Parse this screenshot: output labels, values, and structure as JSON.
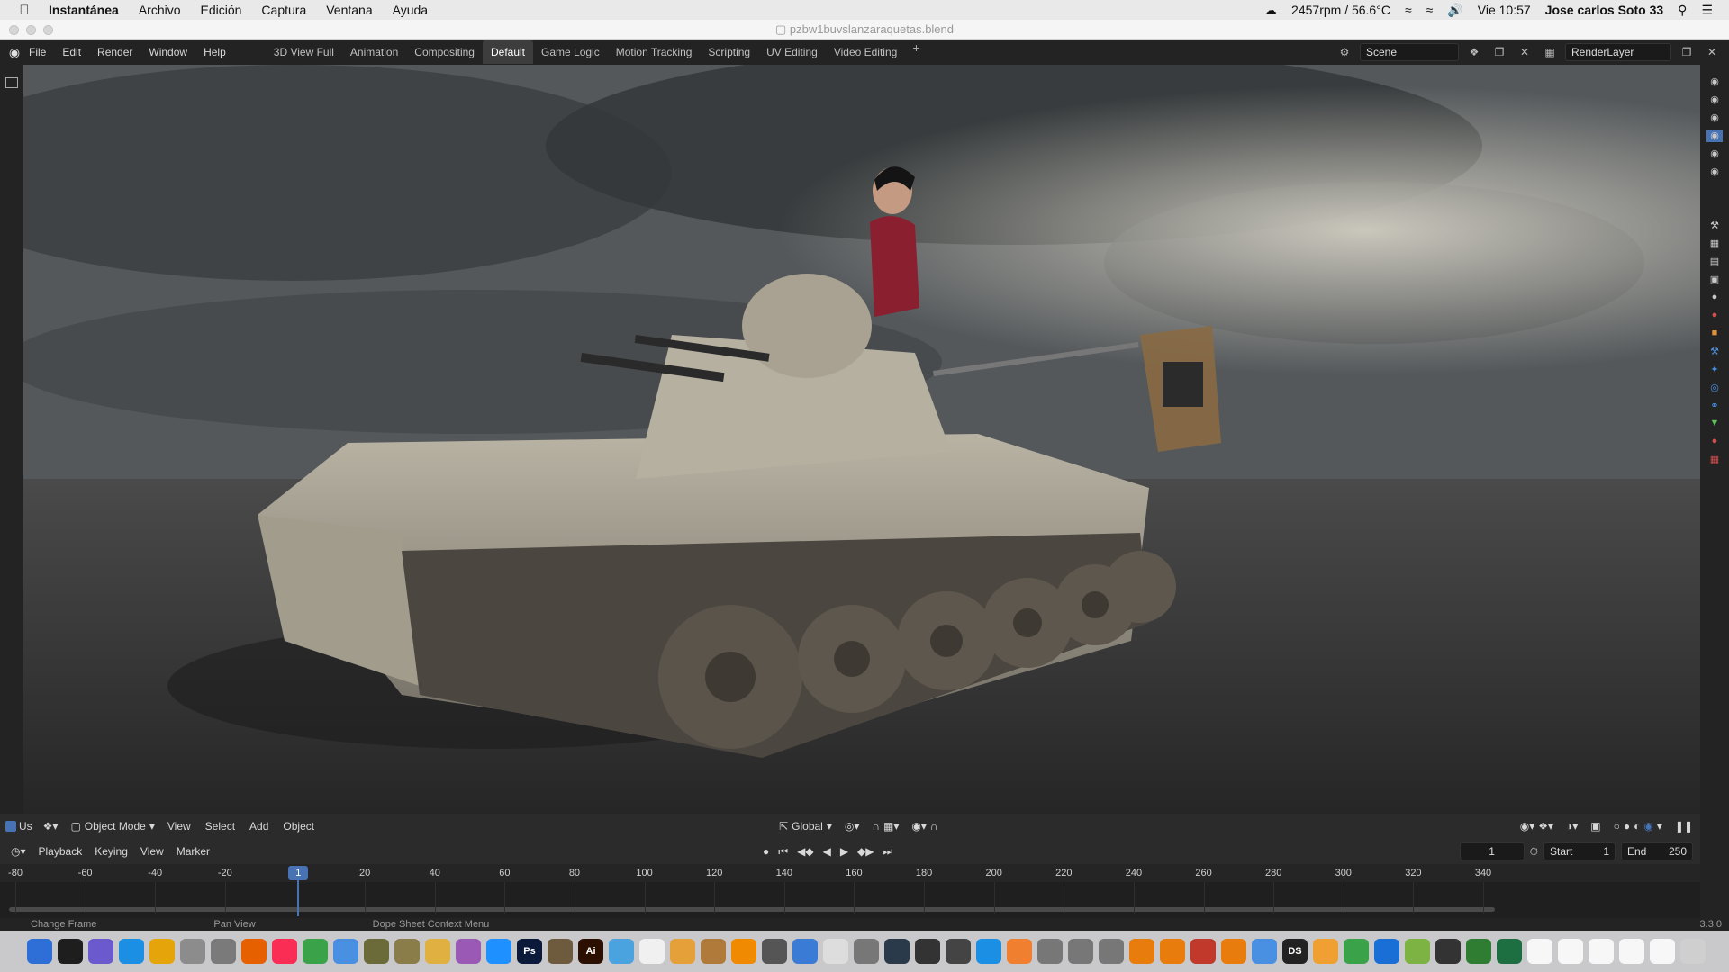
{
  "mac_menubar": {
    "app_name": "Instantánea",
    "menus": [
      "Archivo",
      "Edición",
      "Captura",
      "Ventana",
      "Ayuda"
    ],
    "status": "2457rpm / 56.6°C",
    "clock": "Vie 10:57",
    "user": "Jose carlos Soto 33"
  },
  "window": {
    "title": "pzbw1buvslanzaraquetas.blend"
  },
  "topbar": {
    "menus": [
      "File",
      "Edit",
      "Render",
      "Window",
      "Help"
    ],
    "workspaces": [
      "3D View Full",
      "Animation",
      "Compositing",
      "Default",
      "Game Logic",
      "Motion Tracking",
      "Scripting",
      "UV Editing",
      "Video Editing"
    ],
    "active_workspace": "Default",
    "add_tab": "+",
    "scene": "Scene",
    "render_layer": "RenderLayer"
  },
  "viewport_header": {
    "checkbox_label": "Us",
    "mode": "Object Mode",
    "menus": [
      "View",
      "Select",
      "Add",
      "Object"
    ],
    "orientation": "Global"
  },
  "timeline": {
    "menus": [
      "Playback",
      "Keying",
      "View",
      "Marker"
    ],
    "current_frame": "1",
    "start_label": "Start",
    "start_value": "1",
    "end_label": "End",
    "end_value": "250",
    "ruler_labels": [
      "-80",
      "-60",
      "-40",
      "-20",
      "1",
      "20",
      "40",
      "60",
      "80",
      "100",
      "120",
      "140",
      "160",
      "180",
      "200",
      "220",
      "240",
      "260",
      "280",
      "300",
      "320",
      "340"
    ]
  },
  "statusbar": {
    "items": [
      "Change Frame",
      "Pan View",
      "Dope Sheet Context Menu"
    ],
    "version": "3.3.0"
  },
  "dock": {
    "apps": [
      "finder-icon",
      "terminal-icon",
      "launchpad-icon",
      "safari-icon",
      "chrome-icon",
      "app-icon",
      "rocket-icon",
      "firefox-icon",
      "music-icon",
      "torrent-icon",
      "mail-icon",
      "tank-icon",
      "tank2-icon",
      "notes-icon",
      "affinity-icon",
      "gear-icon",
      "photoshop-icon",
      "gimp-icon",
      "illustrator-icon",
      "globe-icon",
      "textedit-icon",
      "folder-icon",
      "package-icon",
      "vlc-icon",
      "sysprefs-icon",
      "user-icon",
      "image-icon",
      "map-icon",
      "search-icon",
      "pen-icon",
      "calendar-icon",
      "xcode-icon",
      "books-icon",
      "figure-icon",
      "figure2-icon",
      "moon-icon",
      "blender-icon",
      "blender2-icon",
      "s-icon",
      "blender3-icon",
      "files-icon",
      "daz-icon",
      "sketch-icon",
      "pinwheel-icon",
      "bluetooth-icon",
      "android-icon",
      "camera-icon",
      "chess-icon",
      "excel-icon",
      "doc1-icon",
      "doc2-icon",
      "doc3-icon",
      "doc4-icon",
      "doc5-icon",
      "trash-icon"
    ],
    "labels": {
      "photoshop-icon": "Ps",
      "illustrator-icon": "Ai",
      "daz-icon": "DS"
    }
  }
}
